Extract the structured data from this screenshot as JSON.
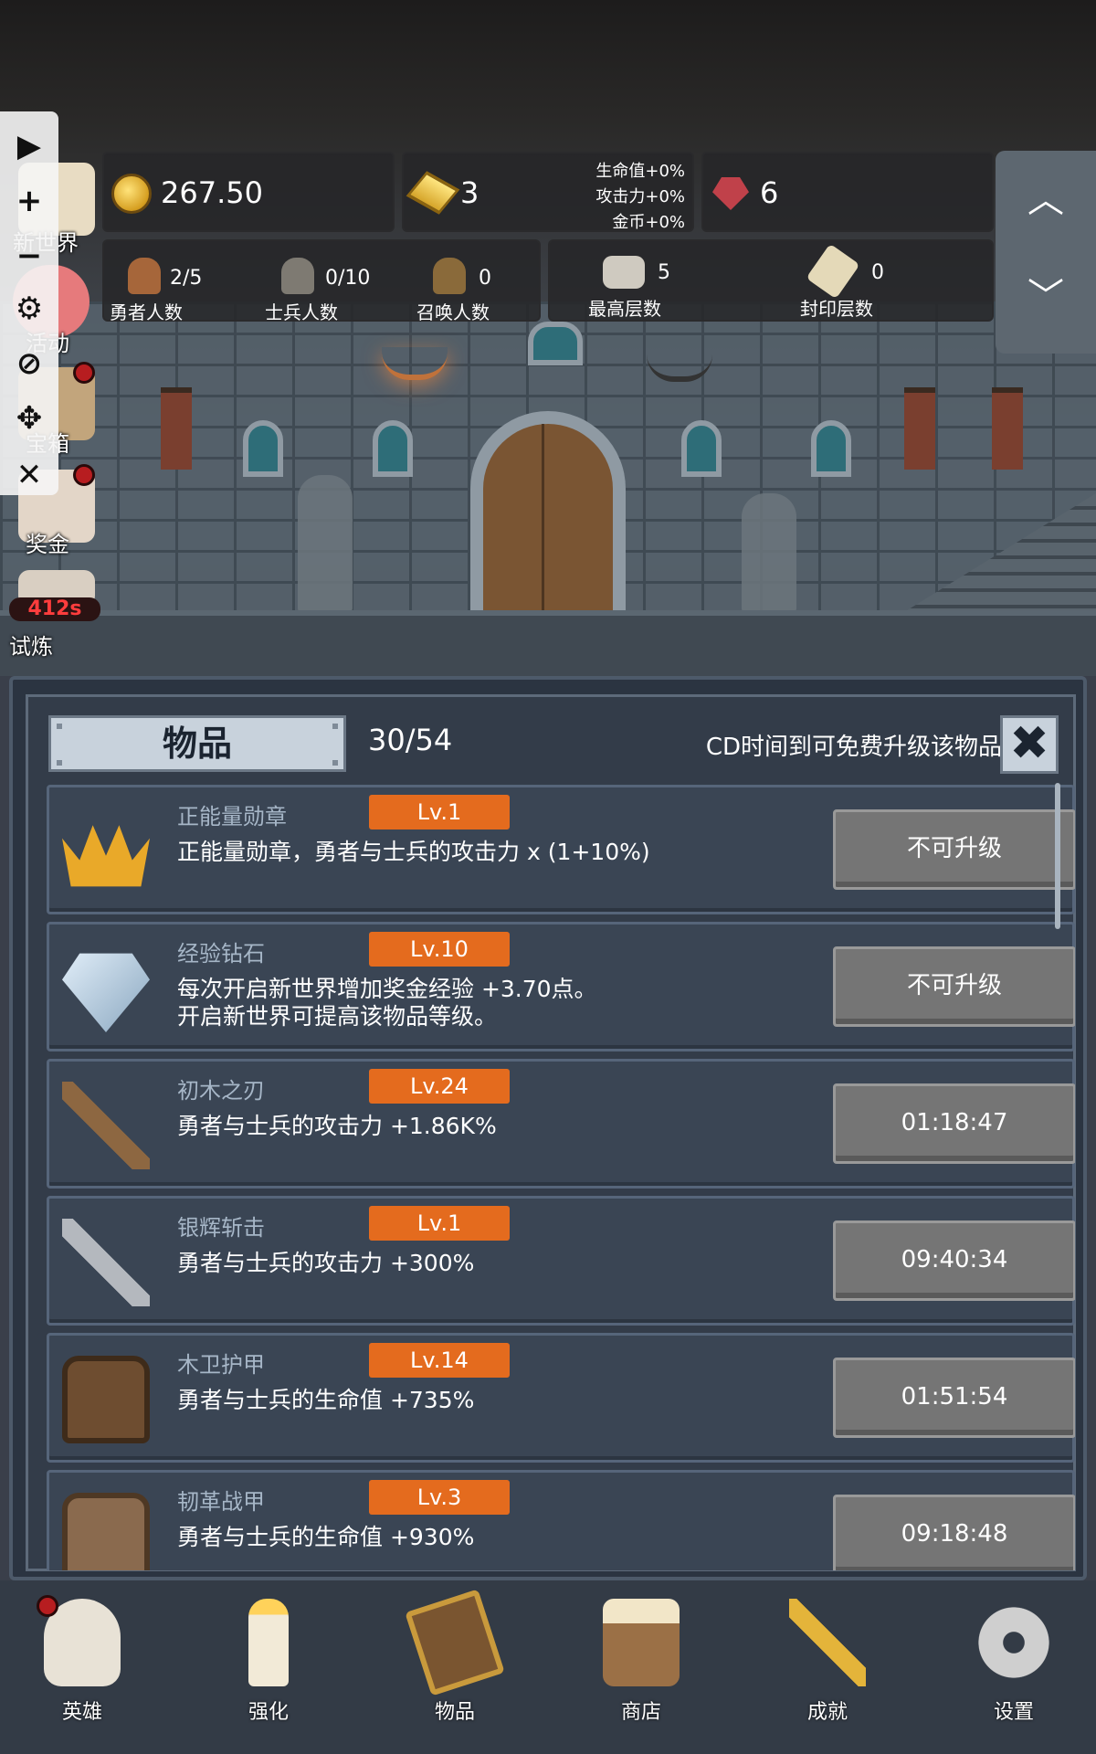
{
  "hud": {
    "gold": "267.50",
    "gold_bars": "3",
    "gems": "6",
    "buffs": [
      "生命值+0%",
      "攻击力+0%",
      "金币+0%"
    ],
    "stats": [
      {
        "value": "2/5",
        "label": "勇者人数"
      },
      {
        "value": "0/10",
        "label": "士兵人数"
      },
      {
        "value": "0",
        "label": "召唤人数"
      },
      {
        "value": "5",
        "label": "最高层数"
      },
      {
        "value": "0",
        "label": "封印层数"
      }
    ]
  },
  "side_menu": {
    "controls": [
      "▶",
      "+",
      "−",
      "⚙",
      "⊘",
      "✥",
      "✕"
    ],
    "items": [
      {
        "label": "新世界"
      },
      {
        "label": "活动"
      },
      {
        "label": "宝箱"
      },
      {
        "label": "奖金"
      },
      {
        "label": "试炼",
        "timer": "412s"
      }
    ]
  },
  "items_panel": {
    "tab_label": "物品",
    "count": "30/54",
    "hint": "CD时间到可免费升级该物品",
    "close_symbol": "✖",
    "items": [
      {
        "name": "正能量勋章",
        "level": "Lv.1",
        "desc": "正能量勋章，勇者与士兵的攻击力 x (1+10%)",
        "button": "不可升级",
        "icon": "medal-icon"
      },
      {
        "name": "经验钻石",
        "level": "Lv.10",
        "desc": "每次开启新世界增加奖金经验 +3.70点。\n开启新世界可提高该物品等级。",
        "button": "不可升级",
        "icon": "diamond-icon"
      },
      {
        "name": "初木之刃",
        "level": "Lv.24",
        "desc": "勇者与士兵的攻击力 +1.86K%",
        "button": "01:18:47",
        "icon": "wooden-sword-icon"
      },
      {
        "name": "银辉斩击",
        "level": "Lv.1",
        "desc": "勇者与士兵的攻击力 +300%",
        "button": "09:40:34",
        "icon": "silver-sword-icon"
      },
      {
        "name": "木卫护甲",
        "level": "Lv.14",
        "desc": "勇者与士兵的生命值 +735%",
        "button": "01:51:54",
        "icon": "wooden-armor-icon"
      },
      {
        "name": "韧革战甲",
        "level": "Lv.3",
        "desc": "勇者与士兵的生命值 +930%",
        "button": "09:18:48",
        "icon": "leather-armor-icon"
      }
    ]
  },
  "nav": [
    {
      "label": "英雄",
      "icon": "skull-icon",
      "badge": true
    },
    {
      "label": "强化",
      "icon": "candle-icon"
    },
    {
      "label": "物品",
      "icon": "book-icon"
    },
    {
      "label": "商店",
      "icon": "mug-icon"
    },
    {
      "label": "成就",
      "icon": "key-icon"
    },
    {
      "label": "设置",
      "icon": "gear-icon"
    }
  ],
  "colors": {
    "level_badge": "#e46b1e",
    "button_gray": "#757575",
    "panel_bg": "#2b3441"
  }
}
